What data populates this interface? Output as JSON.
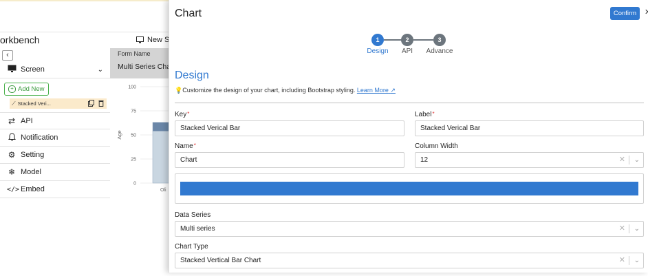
{
  "app": {
    "title": "orkbench",
    "new_screen_label": "New Sc"
  },
  "sidebar": {
    "collapse_glyph": "‹",
    "screen_label": "Screen",
    "add_new_label": "Add New",
    "stacked_item_label": "Stacked Veri...",
    "items": [
      {
        "label": "API",
        "icon": "swap-arrows-icon"
      },
      {
        "label": "Notification",
        "icon": "bell-icon"
      },
      {
        "label": "Setting",
        "icon": "gear-icon"
      },
      {
        "label": "Model",
        "icon": "snowflake-icon"
      },
      {
        "label": "Embed",
        "icon": "code-icon"
      }
    ]
  },
  "canvas": {
    "form_name_header": "Form Name",
    "form_name_value": "Multi Series Char",
    "chart_data": {
      "type": "bar",
      "ylabel": "Age",
      "ylim": [
        0,
        100
      ],
      "y_ticks": [
        "100",
        "75",
        "50",
        "25",
        "0"
      ],
      "categories": [
        "Oli"
      ],
      "series": [
        {
          "values": [
            54
          ],
          "color": "#c9d6e1"
        },
        {
          "values": [
            9
          ],
          "color": "#6b87a8"
        }
      ]
    }
  },
  "panel": {
    "title": "Chart",
    "confirm_label": "Confirm",
    "close_glyph": "✕",
    "steps": [
      {
        "number": "1",
        "label": "Design",
        "active": true
      },
      {
        "number": "2",
        "label": "API",
        "active": false
      },
      {
        "number": "3",
        "label": "Advance",
        "active": false
      }
    ],
    "section_title": "Design",
    "description": "Customize the design of your chart, including Bootstrap styling.",
    "learn_more": "Learn More",
    "fields": {
      "key": {
        "label": "Key",
        "value": "Stacked Verical Bar"
      },
      "label": {
        "label": "Label",
        "value": "Stacked Verical Bar"
      },
      "name": {
        "label": "Name",
        "value": "Chart"
      },
      "column_width": {
        "label": "Column Width",
        "value": "12"
      },
      "data_series": {
        "label": "Data Series",
        "value": "Multi series"
      },
      "chart_type": {
        "label": "Chart Type",
        "value": "Stacked Vertical Bar Chart"
      }
    },
    "color_bar": "#3179d0"
  }
}
